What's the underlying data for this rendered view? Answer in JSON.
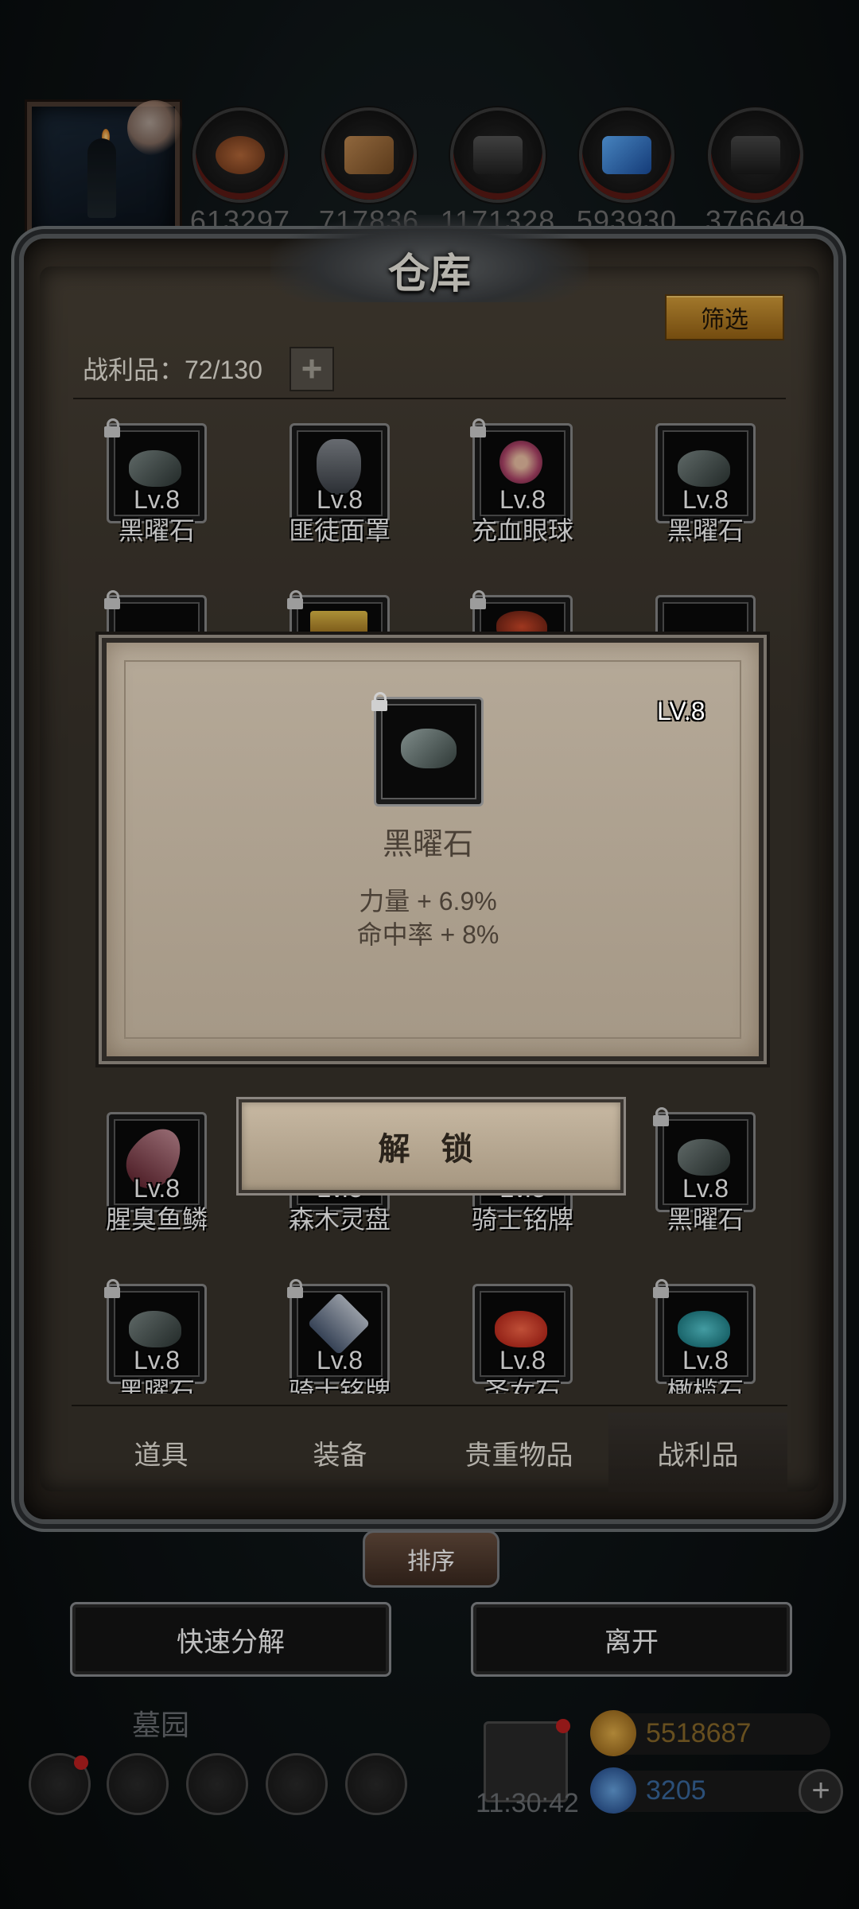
{
  "resources": {
    "counts": [
      "613297",
      "717836",
      "1171328",
      "593930",
      "376649"
    ],
    "icons": [
      "leather-icon",
      "wood-icon",
      "iron-ingot-icon",
      "crystal-icon",
      "steel-ingot-icon"
    ]
  },
  "warehouse": {
    "title": "仓库",
    "filter_label": "筛选",
    "loot_count": "战利品：72/130"
  },
  "grid": {
    "row1": [
      {
        "name": "黑曜石",
        "lv": "Lv.8",
        "locked": true
      },
      {
        "name": "匪徒面罩",
        "lv": "Lv.8",
        "locked": false
      },
      {
        "name": "充血眼球",
        "lv": "Lv.8",
        "locked": true
      },
      {
        "name": "黑曜石",
        "lv": "Lv.8",
        "locked": false
      }
    ],
    "row4": [
      {
        "name": "腥臭鱼鳞",
        "lv": "Lv.8",
        "locked": false
      },
      {
        "name": "森木灵盘",
        "lv": "Lv.8",
        "locked": false
      },
      {
        "name": "骑士铭牌",
        "lv": "Lv.8",
        "locked": false
      },
      {
        "name": "黑曜石",
        "lv": "Lv.8",
        "locked": true
      }
    ],
    "row5": [
      {
        "name": "黑曜石",
        "lv": "Lv.8",
        "locked": true
      },
      {
        "name": "骑士铭牌",
        "lv": "Lv.8",
        "locked": true
      },
      {
        "name": "圣女石",
        "lv": "Lv.8",
        "locked": false
      },
      {
        "name": "橄榄石",
        "lv": "Lv.8",
        "locked": true
      }
    ]
  },
  "tabs": [
    "道具",
    "装备",
    "贵重物品",
    "战利品"
  ],
  "active_tab": "战利品",
  "sort_label": "排序",
  "actions": {
    "decompose": "快速分解",
    "leave": "离开"
  },
  "hud": {
    "location": "墓园",
    "clock": "11:30:42",
    "gold": "5518687",
    "gems": "3205"
  },
  "popup": {
    "level": "LV.8",
    "item_name": "黑曜石",
    "stats": [
      "力量 + 6.9%",
      "命中率 + 8%"
    ],
    "unlock_label": "解 锁"
  },
  "colors": {
    "accent_gold": "#d9a13b",
    "panel_bg": "#3a342c",
    "popup_bg": "#b5a998"
  }
}
